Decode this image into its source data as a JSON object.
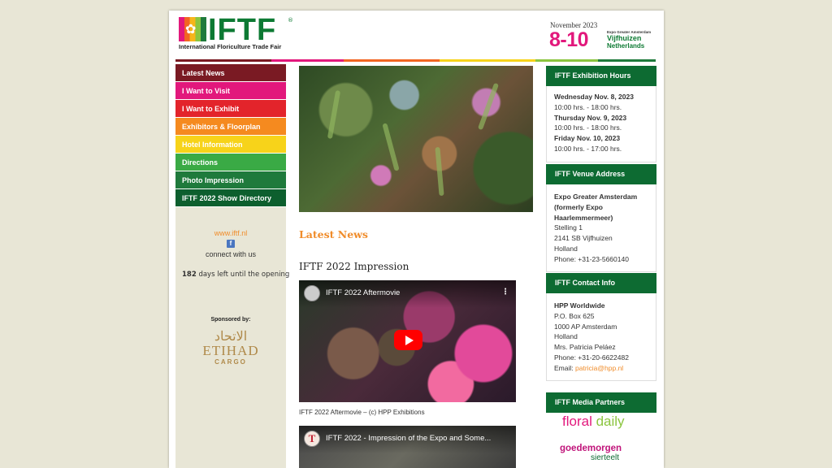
{
  "header": {
    "logo_text": "IFTF",
    "logo_reg": "®",
    "logo_subtitle": "International Floriculture Trade Fair",
    "dates_month": "November 2023",
    "dates_range": "8-10",
    "venue_small": "Expo Greater Amsterdam",
    "venue_city": "Vijfhuizen",
    "venue_country": "Netherlands",
    "colors": {
      "green": "#0d7a33",
      "magenta": "#e2187c"
    }
  },
  "nav": {
    "items": [
      {
        "label": "Latest News",
        "color": "#7a1a23"
      },
      {
        "label": "I Want to Visit",
        "color": "#e2187c"
      },
      {
        "label": "I Want to Exhibit",
        "color": "#e3242b"
      },
      {
        "label": "Exhibitors & Floorplan",
        "color": "#f58a1f"
      },
      {
        "label": "Hotel Information",
        "color": "#f7d31a"
      },
      {
        "label": "Directions",
        "color": "#3aaa45"
      },
      {
        "label": "Photo Impression",
        "color": "#1f7a3c"
      },
      {
        "label": "IFTF 2022 Show Directory",
        "color": "#0d5f2e"
      }
    ]
  },
  "sidebar": {
    "website": "www.iftf.nl",
    "facebook_icon": "facebook-icon",
    "connect": "connect with us",
    "days_count": "182",
    "days_text": "days left until the opening",
    "sponsored_by": "Sponsored by:",
    "sponsor_arabic": "الاتحاد",
    "sponsor_name": "ETIHAD",
    "sponsor_sub": "CARGO"
  },
  "main": {
    "section_title": "Latest News",
    "article_title": "IFTF 2022 Impression",
    "video1": {
      "title": "IFTF 2022 Aftermovie",
      "menu_icon": "more-vertical-icon"
    },
    "video1_caption": "IFTF 2022 Aftermovie – (c) HPP Exhibitions",
    "video2": {
      "title": "IFTF 2022 - Impression of the Expo and Some...",
      "avatar_letter": "T"
    }
  },
  "right": {
    "hours": {
      "title": "IFTF Exhibition Hours",
      "day1": "Wednesday Nov. 8, 2023",
      "time1": "10:00 hrs. - 18:00 hrs.",
      "day2": "Thursday Nov. 9, 2023",
      "time2": "10:00 hrs. - 18:00 hrs.",
      "day3": "Friday Nov. 10, 2023",
      "time3": "10:00 hrs. - 17:00 hrs."
    },
    "venue": {
      "title": "IFTF Venue Address",
      "line1": "Expo Greater Amsterdam",
      "line2": "(formerly Expo",
      "line3": "Haarlemmermeer)",
      "line4": "Stelling 1",
      "line5": "2141 SB Vijfhuizen",
      "line6": "Holland",
      "line7": "Phone: +31-23-5660140"
    },
    "contact": {
      "title": "IFTF Contact Info",
      "line1": "HPP Worldwide",
      "line2": "P.O. Box 625",
      "line3": "1000 AP Amsterdam",
      "line4": "Holland",
      "line5": "Mrs. Patricia Peláez",
      "line6": "Phone: +31-20-6622482",
      "email_label": "Email:",
      "email": "patricia@hpp.nl"
    },
    "media": {
      "title": "IFTF Media Partners",
      "partner1_a": "floral",
      "partner1_b": "daily",
      "partner2_a": "goedemorgen",
      "partner2_b": "sierteelt"
    }
  }
}
